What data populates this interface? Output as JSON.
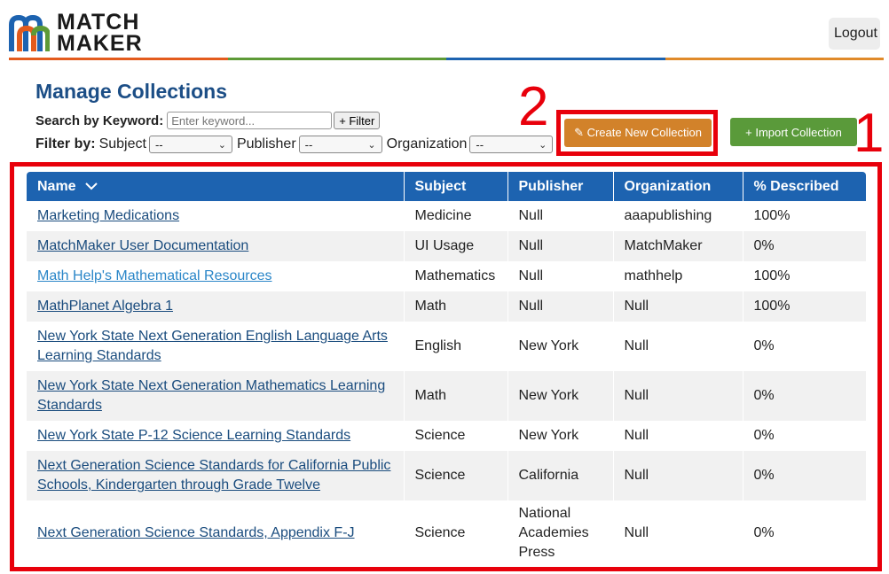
{
  "header": {
    "logo_line1": "MATCH",
    "logo_line2": "MAKER",
    "logout_label": "Logout",
    "rule_colors": [
      "#e35b1d",
      "#5d9a36",
      "#1d63b0",
      "#e08a2a"
    ]
  },
  "page": {
    "title": "Manage Collections"
  },
  "search": {
    "label": "Search by Keyword:",
    "placeholder": "Enter keyword...",
    "button_label": "+ Filter"
  },
  "filters": {
    "label": "Filter by:",
    "subject_label": "Subject",
    "subject_value": "--",
    "publisher_label": "Publisher",
    "publisher_value": "--",
    "organization_label": "Organization",
    "organization_value": "--"
  },
  "actions": {
    "create_label": "Create New Collection",
    "create_icon": "pencil-icon",
    "import_label": "+ Import Collection"
  },
  "annotations": {
    "num1": "1",
    "num2": "2",
    "color": "#e8000b"
  },
  "table": {
    "headers": [
      "Name",
      "Subject",
      "Publisher",
      "Organization",
      "% Described"
    ],
    "sort_icon": "chevron-down-icon",
    "rows": [
      {
        "name": "Marketing Medications",
        "subject": "Medicine",
        "publisher": "Null",
        "organization": "aaapublishing",
        "described": "100%"
      },
      {
        "name": "MatchMaker User Documentation",
        "subject": "UI Usage",
        "publisher": "Null",
        "organization": "MatchMaker",
        "described": "0%"
      },
      {
        "name": "Math Help's Mathematical Resources",
        "subject": "Mathematics",
        "publisher": "Null",
        "organization": "mathhelp",
        "described": "100%"
      },
      {
        "name": "MathPlanet Algebra 1",
        "subject": "Math",
        "publisher": "Null",
        "organization": "Null",
        "described": "100%"
      },
      {
        "name": "New York State Next Generation English Language Arts Learning Standards",
        "subject": "English",
        "publisher": "New York",
        "organization": "Null",
        "described": "0%"
      },
      {
        "name": "New York State Next Generation Mathematics Learning Standards",
        "subject": "Math",
        "publisher": "New York",
        "organization": "Null",
        "described": "0%"
      },
      {
        "name": "New York State P-12 Science Learning Standards",
        "subject": "Science",
        "publisher": "New York",
        "organization": "Null",
        "described": "0%"
      },
      {
        "name": "Next Generation Science Standards for California Public Schools, Kindergarten through Grade Twelve",
        "subject": "Science",
        "publisher": "California",
        "organization": "Null",
        "described": "0%"
      },
      {
        "name": "Next Generation Science Standards, Appendix F-J",
        "subject": "Science",
        "publisher": "National Academies Press",
        "organization": "Null",
        "described": "0%"
      }
    ]
  }
}
